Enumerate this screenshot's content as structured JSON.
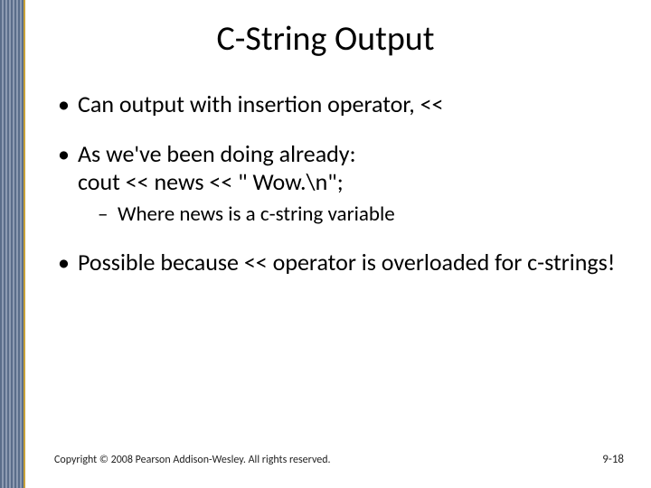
{
  "title": "C-String Output",
  "bullets": {
    "b1": "Can output with insertion operator, <<",
    "b2_line1": "As we've been doing already:",
    "b2_line2": "cout << news << \" Wow.\\n\";",
    "b2_sub": "Where news is a c-string variable",
    "b3": "Possible because << operator is overloaded for c-strings!"
  },
  "footer": {
    "copyright": "Copyright © 2008 Pearson Addison-Wesley. All rights reserved.",
    "page": "9-18"
  }
}
